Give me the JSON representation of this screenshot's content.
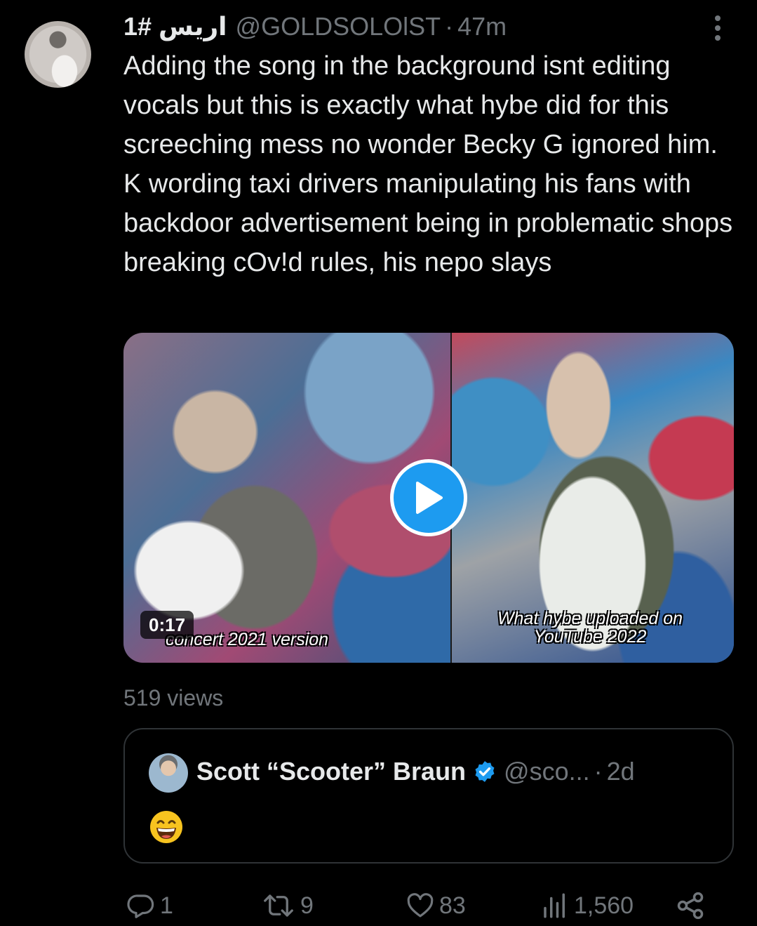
{
  "tweet": {
    "display_name": "اريس #1",
    "handle": "@GOLDSOLOlST",
    "separator": "·",
    "time": "47m",
    "text": "Adding the song in the background isnt editing vocals but this is exactly what hybe did for this screeching mess no wonder Becky G ignored him. K wording taxi drivers manipulating his fans with backdoor advertisement being in problematic shops breaking cOv!d rules, his nepo slays",
    "views_label": "519 views"
  },
  "media": {
    "duration": "0:17",
    "caption_left": "concert 2021 version",
    "caption_right": "What hybe uploaded on YouTube 2022",
    "icon_play": "play-icon"
  },
  "quote": {
    "name": "Scott “Scooter” Braun",
    "handle": "@sco...",
    "separator": "·",
    "time": "2d",
    "emoji": "😄",
    "icon_verified": "verified-badge-icon"
  },
  "actions": {
    "replies": "1",
    "retweets": "9",
    "likes": "83",
    "views": "1,560",
    "icon_reply": "reply-icon",
    "icon_retweet": "retweet-icon",
    "icon_like": "heart-icon",
    "icon_views": "views-chart-icon",
    "icon_share": "share-icon"
  },
  "colors": {
    "background": "#000000",
    "text": "#e7e9ea",
    "muted": "#71767b",
    "accent": "#1d9bf0",
    "border": "#2f3336"
  }
}
